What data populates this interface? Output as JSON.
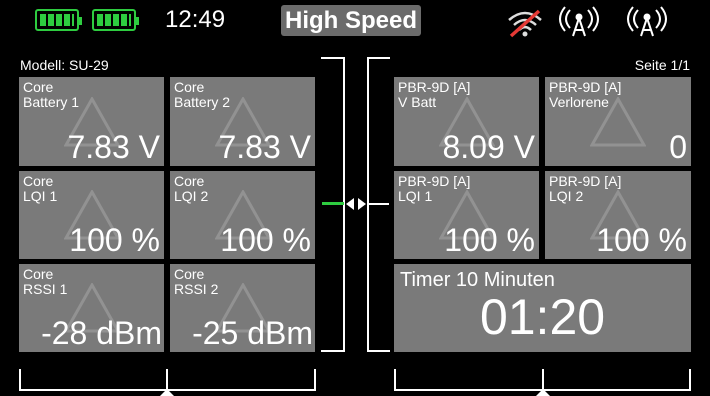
{
  "status": {
    "battery1_icon": "battery-full-icon",
    "battery2_icon": "battery-full-icon",
    "time": "12:49",
    "mode": "High Speed",
    "signal_icons": [
      "wifi-off-icon",
      "antenna-icon",
      "antenna-icon"
    ]
  },
  "left_header": "Modell: SU-29",
  "right_header": "Seite 1/1",
  "left_tiles": [
    {
      "line1": "Core",
      "line2": "Battery 1",
      "value": "7.83 V"
    },
    {
      "line1": "Core",
      "line2": "Battery 2",
      "value": "7.83 V"
    },
    {
      "line1": "Core",
      "line2": "LQI 1",
      "value": "100 %"
    },
    {
      "line1": "Core",
      "line2": "LQI 2",
      "value": "100 %"
    },
    {
      "line1": "Core",
      "line2": "RSSI 1",
      "value": "-28 dBm"
    },
    {
      "line1": "Core",
      "line2": "RSSI 2",
      "value": "-25 dBm"
    }
  ],
  "right_tiles": [
    {
      "line1": "PBR-9D [A]",
      "line2": "V Batt",
      "value": "8.09 V"
    },
    {
      "line1": "PBR-9D [A]",
      "line2": "Verlorene",
      "value": "0"
    },
    {
      "line1": "PBR-9D [A]",
      "line2": "LQI 1",
      "value": "100 %"
    },
    {
      "line1": "PBR-9D [A]",
      "line2": "LQI 2",
      "value": "100 %"
    }
  ],
  "timer": {
    "label": "Timer 10 Minuten",
    "value": "01:20"
  },
  "colors": {
    "tile": "#7a7a7a",
    "battery": "#2ecc40",
    "wifi_off": "#e53935",
    "background": "#000000"
  }
}
